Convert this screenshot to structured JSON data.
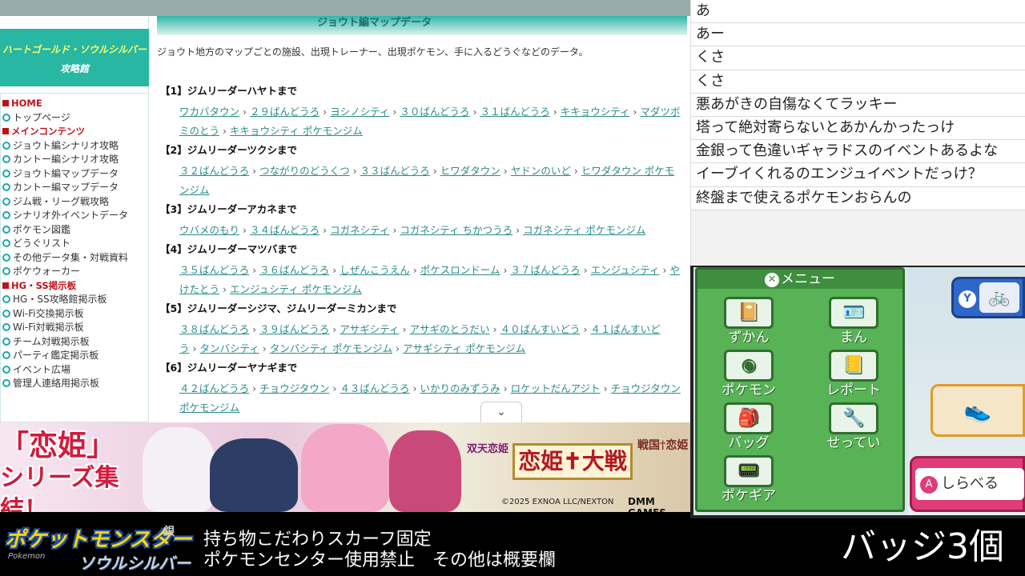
{
  "sidebar": {
    "logo_line1": "ハートゴールド・ソウルシルバー",
    "logo_line2": "攻略館",
    "groups": [
      {
        "heading": "HOME",
        "items": [
          "トップページ"
        ]
      },
      {
        "heading": "メインコンテンツ",
        "items": [
          "ジョウト編シナリオ攻略",
          "カントー編シナリオ攻略",
          "ジョウト編マップデータ",
          "カントー編マップデータ",
          "ジム戦・リーグ戦攻略",
          "シナリオ外イベントデータ",
          "ポケモン図鑑",
          "どうぐリスト",
          "その他データ集・対戦資料",
          "ポケウォーカー"
        ]
      },
      {
        "heading": "HG・SS掲示板",
        "items": [
          "HG・SS攻略館掲示板",
          "Wi-Fi交換掲示板",
          "Wi-Fi対戦掲示板",
          "チーム対戦掲示板",
          "パーティ鑑定掲示板",
          "イベント広場",
          "管理人連絡用掲示板"
        ]
      }
    ]
  },
  "content": {
    "header": "ジョウト編マップデータ",
    "description": "ジョウト地方のマップごとの施設、出現トレーナー、出現ポケモン、手に入るどうぐなどのデータ。",
    "sections": [
      {
        "title": "【1】ジムリーダーハヤトまで",
        "links": [
          "ワカバタウン",
          "２９ばんどうろ",
          "ヨシノシティ",
          "３０ばんどうろ",
          "３１ばんどうろ",
          "キキョウシティ",
          "マダツボミのとう",
          "キキョウシティ ポケモンジム"
        ]
      },
      {
        "title": "【2】ジムリーダーツクシまで",
        "links": [
          "３２ばんどうろ",
          "つながりのどうくつ",
          "３３ばんどうろ",
          "ヒワダタウン",
          "ヤドンのいど",
          "ヒワダタウン ポケモンジム"
        ]
      },
      {
        "title": "【3】ジムリーダーアカネまで",
        "links": [
          "ウバメのもり",
          "３４ばんどうろ",
          "コガネシティ",
          "コガネシティ ちかつうろ",
          "コガネシティ ポケモンジム"
        ]
      },
      {
        "title": "【4】ジムリーダーマツバまで",
        "links": [
          "３５ばんどうろ",
          "３６ばんどうろ",
          "しぜんこうえん",
          "ポケスロンドーム",
          "３７ばんどうろ",
          "エンジュシティ",
          "やけたとう",
          "エンジュシティ ポケモンジム"
        ]
      },
      {
        "title": "【5】ジムリーダーシジマ、ジムリーダーミカンまで",
        "links": [
          "３８ばんどうろ",
          "３９ばんどうろ",
          "アサギシティ",
          "アサギのとうだい",
          "４０ばんすいどう",
          "４１ばんすいどう",
          "タンバシティ",
          "タンバシティ ポケモンジム",
          "アサギシティ ポケモンジム"
        ]
      },
      {
        "title": "【6】ジムリーダーヤナギまで",
        "links": [
          "４２ばんどうろ",
          "チョウジタウン",
          "４３ばんどうろ",
          "いかりのみずうみ",
          "ロケットだんアジト",
          "チョウジタウン ポケモンジム"
        ]
      }
    ],
    "separator": "›"
  },
  "ad": {
    "title_line1": "「恋姫」",
    "title_line2": "シリーズ集結！",
    "logo_main": "恋姫✝大戦",
    "logo_left": "双天恋姫",
    "logo_right": "戦国†恋姫",
    "copyright": "©2025 EXNOA LLC/NEXTON",
    "brand": "DMM GAMES"
  },
  "comments": [
    "あ",
    "あー",
    "くさ",
    "くさ",
    "悪あがきの自傷なくてラッキー",
    "塔って絶対寄らないとあかんかったっけ",
    "金銀って色違いギャラドスのイベントあるよな",
    "イーブイくれるのエンジュイベントだっけ？",
    "終盤まで使えるポケモンおらんの"
  ],
  "ds": {
    "menu_title": "メニュー",
    "menu_close": "✕",
    "items": [
      "ずかん",
      "まん",
      "ポケモン",
      "レポート",
      "バッグ",
      "せってい",
      "ポケギア"
    ],
    "register_button": "Y",
    "inspect_label": "しらべる",
    "inspect_button": "A"
  },
  "bottom": {
    "logo_title": "ポケットモンスター",
    "logo_version": "銀",
    "logo_sub": "Pokemon",
    "logo_soulsilver": "ソウルシルバー",
    "rule_line1": "持ち物こだわりスカーフ固定",
    "rule_line2": "ポケモンセンター使用禁止　その他は概要欄",
    "badges": "バッジ3個"
  }
}
